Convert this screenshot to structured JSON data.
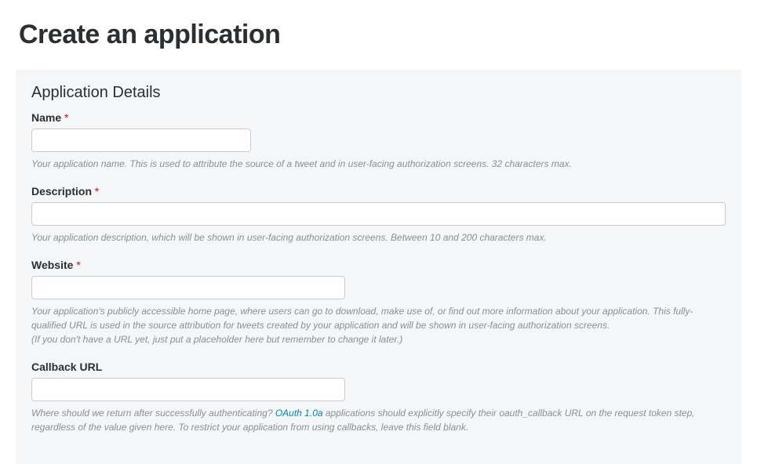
{
  "page": {
    "title": "Create an application"
  },
  "section": {
    "heading": "Application Details"
  },
  "fields": {
    "name": {
      "label": "Name",
      "required_marker": "*",
      "help": "Your application name. This is used to attribute the source of a tweet and in user-facing authorization screens. 32 characters max."
    },
    "description": {
      "label": "Description",
      "required_marker": "*",
      "help": "Your application description, which will be shown in user-facing authorization screens. Between 10 and 200 characters max."
    },
    "website": {
      "label": "Website",
      "required_marker": "*",
      "help_line1": "Your application's publicly accessible home page, where users can go to download, make use of, or find out more information about your application. This fully-qualified URL is used in the source attribution for tweets created by your application and will be shown in user-facing authorization screens.",
      "help_line2": "(If you don't have a URL yet, just put a placeholder here but remember to change it later.)"
    },
    "callback": {
      "label": "Callback URL",
      "help_before": "Where should we return after successfully authenticating? ",
      "help_link_text": "OAuth 1.0a",
      "help_after": " applications should explicitly specify their oauth_callback URL on the request token step, regardless of the value given here. To restrict your application from using callbacks, leave this field blank."
    }
  }
}
